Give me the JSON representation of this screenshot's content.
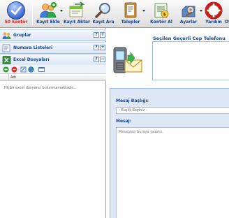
{
  "toolbar": {
    "credit": {
      "label": "50 kontör",
      "icon": "credit-check-icon"
    },
    "buttons": [
      {
        "label": "Kayıt Ekle",
        "icon": "add-user-icon",
        "has_menu": true
      },
      {
        "label": "Kayıt Aktar",
        "icon": "transfer-icon",
        "has_menu": false
      },
      {
        "label": "Kayıt Ara",
        "icon": "search-icon",
        "has_menu": false
      },
      {
        "label": "Talepler",
        "icon": "requests-icon",
        "has_menu": true
      },
      {
        "label": "Kontör Al",
        "icon": "buy-credit-icon",
        "has_menu": false
      },
      {
        "label": "Ayarlar",
        "icon": "settings-icon",
        "has_menu": true
      },
      {
        "label": "Yardım",
        "icon": "help-icon",
        "has_menu": false
      },
      {
        "label": "Ot",
        "icon": "",
        "has_menu": false
      }
    ]
  },
  "left_panel": {
    "sections": [
      {
        "title": "Gruplar",
        "icon": "groups-icon",
        "tools": [
          "?",
          "+"
        ]
      },
      {
        "title": "Numara Listeleri",
        "icon": "number-list-icon",
        "tools": [
          "?",
          "+"
        ]
      },
      {
        "title": "Excel Dosyaları",
        "icon": "excel-icon",
        "tools": [
          "?",
          "−"
        ]
      }
    ],
    "grid": {
      "column_header": "Adı",
      "empty_text": "Hiçbir excel dosyanız bulunmamaktadır..."
    }
  },
  "right_panel": {
    "phone_title": "Seçilen Geçerli Cep Telefonu",
    "subject_label": "Mesaj Başlığı:",
    "subject_value": "- Başlık Seçiniz -",
    "message_label": "Mesaj:",
    "message_placeholder": "Mesajınızı buraya yazınız."
  }
}
